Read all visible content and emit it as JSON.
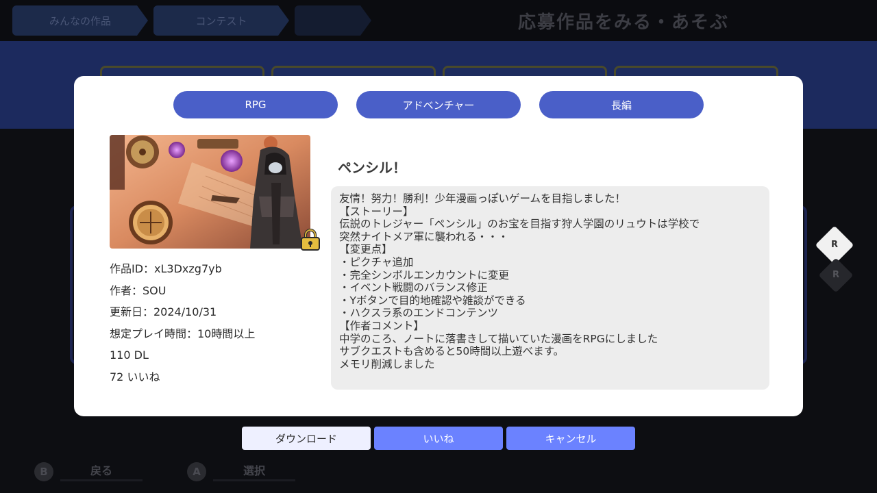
{
  "breadcrumbs": [
    "みんなの作品",
    "コンテスト"
  ],
  "page_title": "応募作品をみる・あそぶ",
  "side_buttons": {
    "r1": "R",
    "r2": "R"
  },
  "hints": [
    {
      "key": "B",
      "label": "戻る"
    },
    {
      "key": "A",
      "label": "選択"
    }
  ],
  "modal": {
    "tags": [
      "RPG",
      "アドベンチャー",
      "長編"
    ],
    "title": "ペンシル！",
    "meta": {
      "id": "作品ID：xL3Dxzg7yb",
      "author": "作者：SOU",
      "updated": "更新日：2024/10/31",
      "playtime": "想定プレイ時間：10時間以上",
      "downloads": "110 DL",
      "likes": "72 いいね"
    },
    "description": "友情！努力！勝利！少年漫画っぽいゲームを目指しました！\n【ストーリー】\n伝説のトレジャー「ペンシル」のお宝を目指す狩人学園のリュウトは学校で\n突然ナイトメア軍に襲われる・・・\n【変更点】\n・ピクチャ追加\n・完全シンボルエンカウントに変更\n・イベント戦闘のバランス修正\n・Yボタンで目的地確認や雑談ができる\n・ハクスラ系のエンドコンテンツ\n【作者コメント】\n中学のころ、ノートに落書きして描いていた漫画をRPGにしました\nサブクエストも含めると50時間以上遊べます。\nメモリ削減しました"
  },
  "actions": {
    "download": "ダウンロード",
    "like": "いいね",
    "cancel": "キャンセル"
  },
  "colors": {
    "tag_bg": "#4a5fc8",
    "action_primary": "#6b82ff",
    "action_selected": "#eef0ff",
    "band": "#1c2a5e"
  }
}
